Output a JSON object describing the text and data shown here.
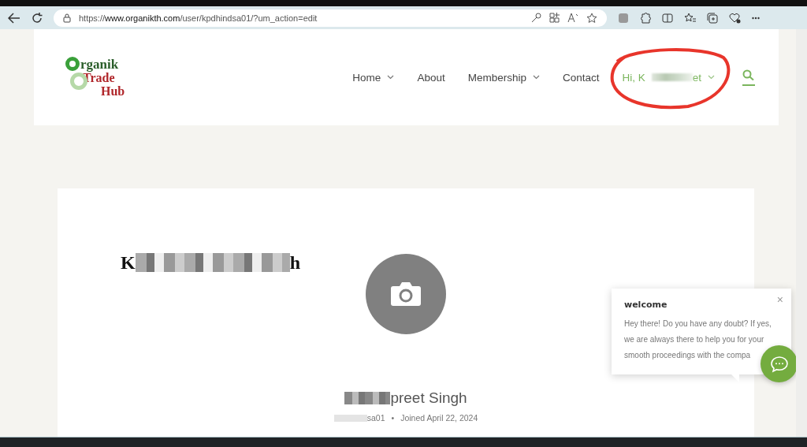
{
  "browser": {
    "url_prefix": "https://",
    "url_domain": "www.organikth.com",
    "url_path": "/user/kpdhindsa01/?um_action=edit"
  },
  "header": {
    "logo": {
      "line1": "rganik",
      "line2": "Trade",
      "line3": "Hub"
    },
    "nav": [
      {
        "label": "Home",
        "dropdown": true
      },
      {
        "label": "About",
        "dropdown": false
      },
      {
        "label": "Membership",
        "dropdown": true
      },
      {
        "label": "Contact",
        "dropdown": false
      }
    ],
    "user_menu": {
      "greeting": "Hi, K",
      "greeting_end": "et",
      "dropdown": true
    }
  },
  "annotations": [
    {
      "kind": "ellipse"
    }
  ],
  "profile": {
    "heading_start": "K",
    "heading_end": "h",
    "display_name": "preet Singh",
    "username": "sa01",
    "separator": "•",
    "joined": "Joined April 22, 2024"
  },
  "chat": {
    "title": "welcome",
    "close": "×",
    "message": "Hey there! Do you have any doubt? If yes, we are always there to help you for your smooth proceedings with the compa"
  }
}
